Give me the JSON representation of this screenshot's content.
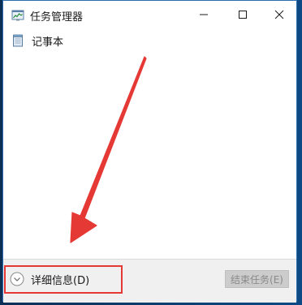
{
  "window": {
    "title": "任务管理器",
    "icon": "task-manager-icon",
    "controls": {
      "minimize_icon": "minimize-icon",
      "maximize_icon": "maximize-icon",
      "close_icon": "close-icon"
    }
  },
  "tasks": [
    {
      "label": "记事本",
      "icon": "notepad-icon"
    }
  ],
  "footer": {
    "details_label": "详细信息(D)",
    "details_icon": "chevron-down-circle-icon",
    "end_task_label": "结束任务(E)",
    "end_task_enabled": false
  },
  "colors": {
    "desktop": "#0d4a85",
    "window_border": "#2f6fb0",
    "footer_bg": "#f0f0f0",
    "annotation_red": "#e53935",
    "disabled_button": "#cccccc"
  },
  "annotations": {
    "arrow": "red-arrow-pointing-to-details",
    "highlight": "red-box-around-details"
  }
}
